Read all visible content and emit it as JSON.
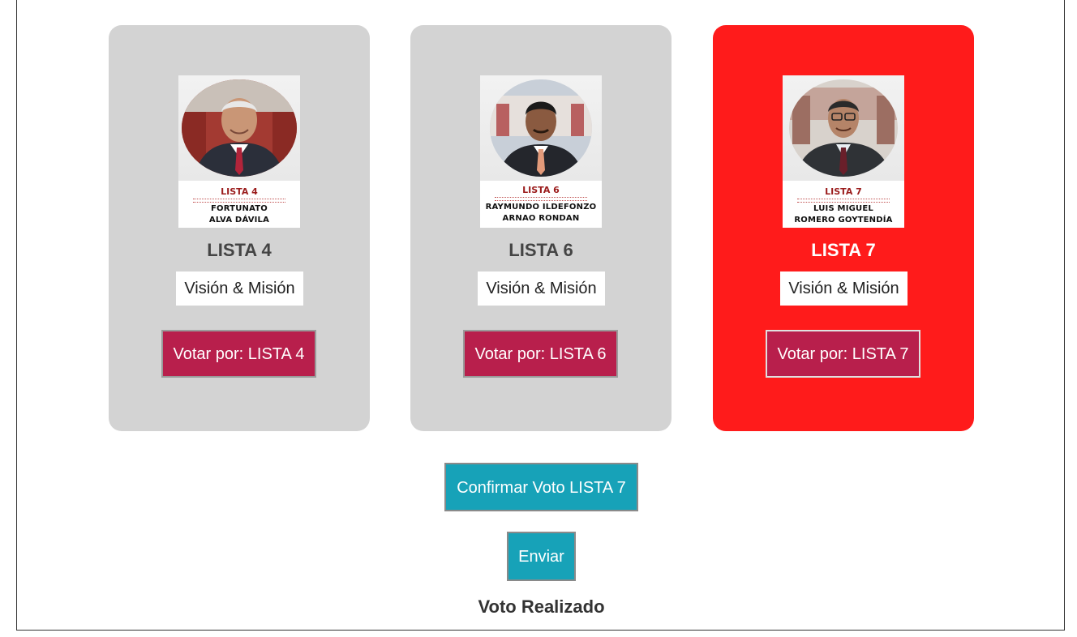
{
  "cards": [
    {
      "title": "LISTA 4",
      "photo_list": "LISTA 4",
      "photo_name_line1": "FORTUNATO",
      "photo_name_line2": "ALVA DÁVILA",
      "mission_label": "Visión & Misión",
      "vote_label": "Votar por: LISTA 4",
      "selected": false
    },
    {
      "title": "LISTA 6",
      "photo_list": "LISTA 6",
      "photo_name_line1": "RAYMUNDO ILDEFONZO",
      "photo_name_line2": "ARNAO RONDAN",
      "mission_label": "Visión & Misión",
      "vote_label": "Votar por: LISTA 6",
      "selected": false
    },
    {
      "title": "LISTA 7",
      "photo_list": "LISTA 7",
      "photo_name_line1": "LUIS MIGUEL",
      "photo_name_line2": "ROMERO GOYTENDÍA",
      "mission_label": "Visión & Misión",
      "vote_label": "Votar por: LISTA 7",
      "selected": true
    }
  ],
  "confirm_label": "Confirmar Voto LISTA 7",
  "send_label": "Enviar",
  "status_text": "Voto Realizado",
  "colors": {
    "card_bg": "#d3d3d3",
    "selected_card_bg": "#ff1b1b",
    "vote_button": "#b81f4c",
    "action_button": "#17a2b8"
  }
}
